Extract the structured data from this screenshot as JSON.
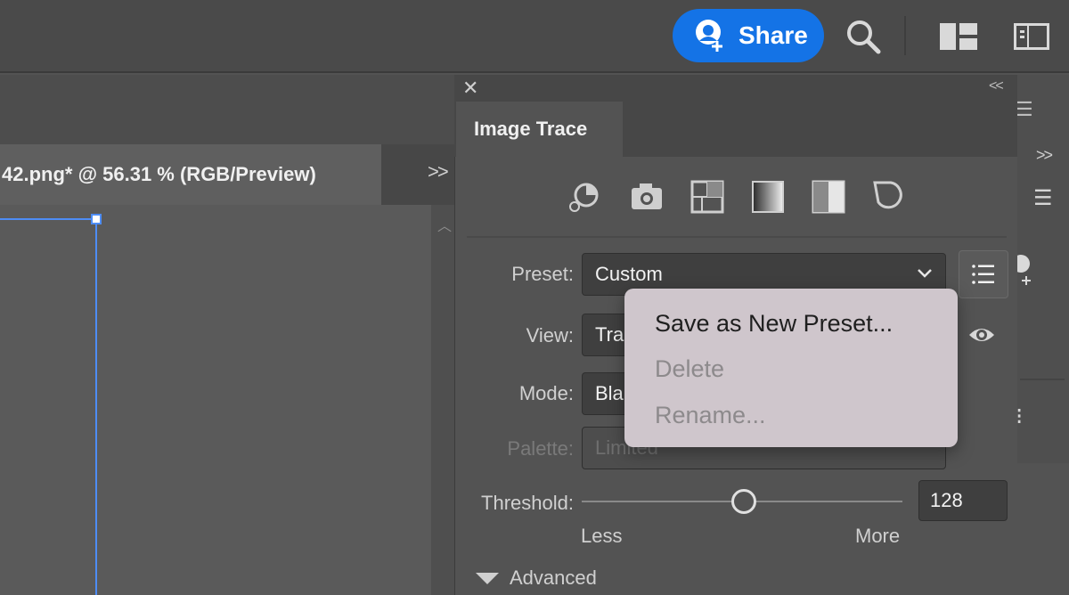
{
  "topbar": {
    "share_label": "Share",
    "icons": [
      "share-user-icon",
      "search-icon",
      "workspace-layout-icon",
      "panel-toggle-icon"
    ],
    "accent": "#1473e6"
  },
  "document": {
    "tab_title": "42.png* @ 56.31 % (RGB/Preview)",
    "overflow_label": ">>"
  },
  "panel": {
    "tab_label": "Image Trace",
    "collapse_label": "<<",
    "close_label": "✕",
    "preset_icons": [
      "auto-color-icon",
      "high-color-icon",
      "low-color-icon",
      "grayscale-icon",
      "black-white-icon",
      "outline-icon"
    ],
    "fields": {
      "preset": {
        "label": "Preset:",
        "value": "Custom"
      },
      "view": {
        "label": "View:",
        "value": "Tra"
      },
      "mode": {
        "label": "Mode:",
        "value": "Bla"
      },
      "palette": {
        "label": "Palette:",
        "value": "Limited"
      }
    },
    "threshold": {
      "label": "Threshold:",
      "value": "128",
      "min_label": "Less",
      "max_label": "More",
      "fraction": 0.5
    },
    "advanced_label": "Advanced"
  },
  "preset_menu": {
    "items": [
      {
        "label": "Save as New Preset...",
        "enabled": true
      },
      {
        "label": "Delete",
        "enabled": false
      },
      {
        "label": "Rename...",
        "enabled": false
      }
    ]
  },
  "right_strip": {
    "overflow_label": ">>"
  }
}
